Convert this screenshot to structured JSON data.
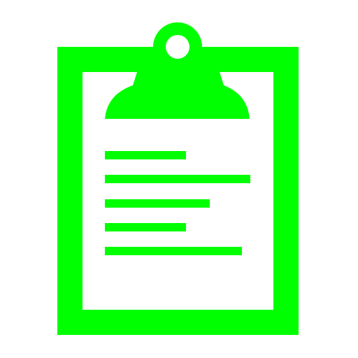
{
  "icon": {
    "name": "clipboard-icon",
    "accent_color": "#00ff00",
    "background_color": "#ffffff"
  }
}
